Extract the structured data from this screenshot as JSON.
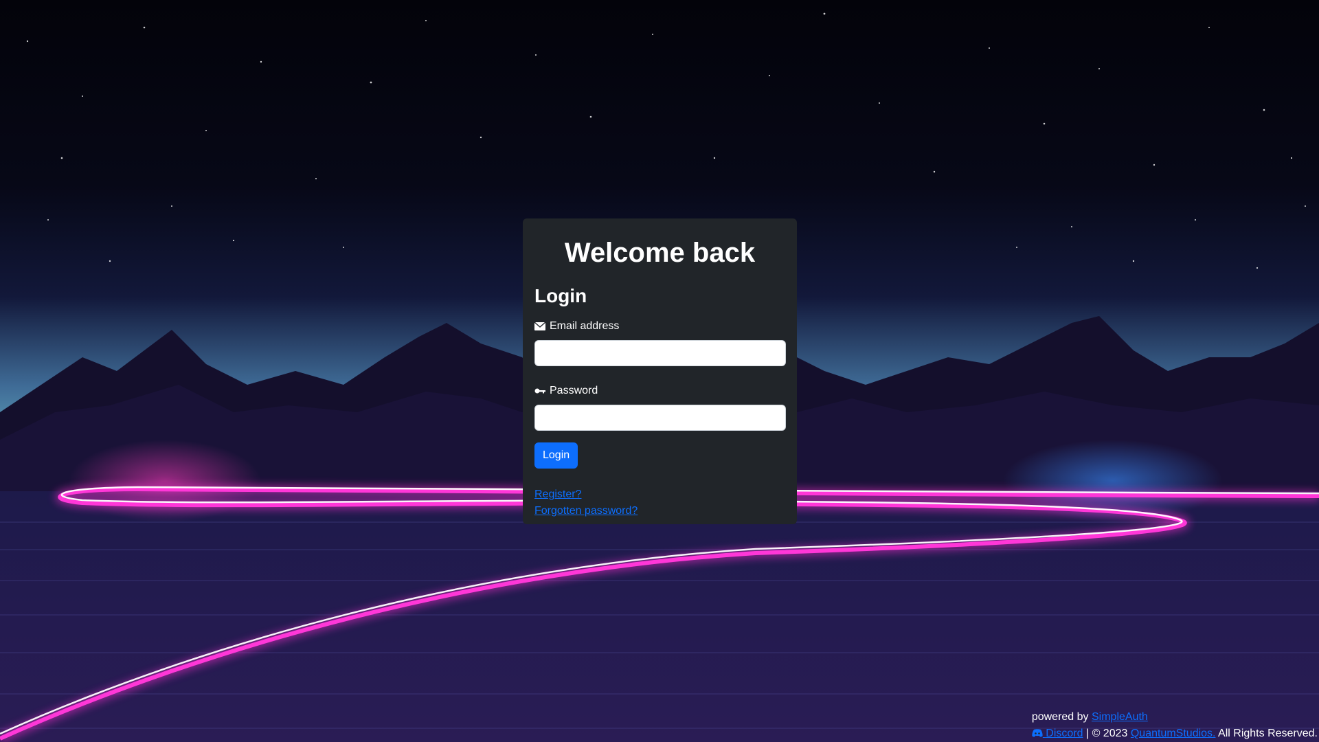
{
  "login_card": {
    "heading": "Welcome back",
    "form_title": "Login",
    "email_label": "Email address",
    "email_icon": "envelope-icon",
    "email_value": "",
    "password_label": "Password",
    "password_icon": "key-icon",
    "password_value": "",
    "submit_label": "Login",
    "register_link": "Register?",
    "forgot_link": "Forgotten password?"
  },
  "footer": {
    "powered_by_prefix": "powered by",
    "powered_by_link": "SimpleAuth",
    "discord_icon": "discord-icon",
    "discord_link": "Discord",
    "separator": "| © 2023",
    "studio_link": "QuantumStudios.",
    "rights": "All Rights Reserved."
  },
  "colors": {
    "card_background": "#212529",
    "primary": "#0d6efd",
    "neon_trail": "#ff2fd2"
  }
}
